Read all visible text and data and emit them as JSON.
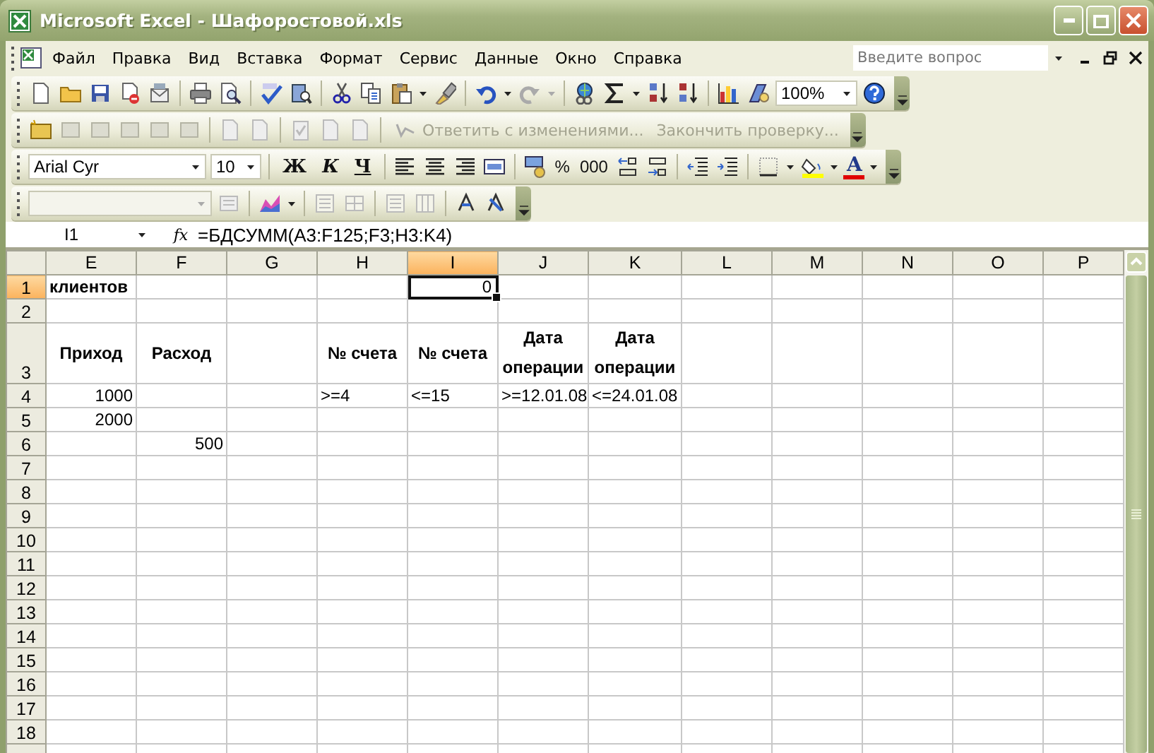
{
  "window": {
    "title": "Microsoft Excel - Шафоростовой.xls"
  },
  "menu": {
    "items": [
      {
        "label": "Файл"
      },
      {
        "label": "Правка"
      },
      {
        "label": "Вид"
      },
      {
        "label": "Вставка"
      },
      {
        "label": "Формат"
      },
      {
        "label": "Сервис"
      },
      {
        "label": "Данные"
      },
      {
        "label": "Окно"
      },
      {
        "label": "Справка"
      }
    ],
    "help_search": {
      "placeholder": "Введите вопрос"
    }
  },
  "standard_toolbar": {
    "zoom": "100%"
  },
  "reviewing_toolbar": {
    "buttons": [
      {
        "label": "Ответить с изменениями...",
        "disabled": true
      },
      {
        "label": "Закончить проверку...",
        "disabled": true
      }
    ]
  },
  "formatting_toolbar": {
    "font": "Arial Cyr",
    "size": "10",
    "style_buttons": [
      {
        "label": "Ж",
        "kind": "bold"
      },
      {
        "label": "К",
        "kind": "italic"
      },
      {
        "label": "Ч",
        "kind": "underline"
      }
    ],
    "number_buttons": [
      {
        "label": "%"
      },
      {
        "label": "000"
      }
    ],
    "font_color_label": "A"
  },
  "formula_bar": {
    "name_box": "I1",
    "function_label": "fx",
    "formula": "=БДСУММ(A3:F125;F3;H3:K4)"
  },
  "sheet": {
    "columns": [
      {
        "label": "E",
        "selected": false
      },
      {
        "label": "F",
        "selected": false
      },
      {
        "label": "G",
        "selected": false
      },
      {
        "label": "H",
        "selected": false
      },
      {
        "label": "I",
        "selected": true
      },
      {
        "label": "J",
        "selected": false
      },
      {
        "label": "K",
        "selected": false
      },
      {
        "label": "L",
        "selected": false
      },
      {
        "label": "M",
        "selected": false
      },
      {
        "label": "N",
        "selected": false
      },
      {
        "label": "O",
        "selected": false
      },
      {
        "label": "P",
        "selected": false
      }
    ],
    "rows": [
      {
        "header": "1",
        "selected": true,
        "cells": [
          {
            "text": "клиентов",
            "kind": "title",
            "selected": false
          },
          null,
          null,
          null,
          {
            "text": "0",
            "kind": "number",
            "selected": true
          },
          null,
          null,
          null,
          null,
          null,
          null,
          null
        ]
      },
      {
        "header": "2",
        "selected": false,
        "cells": [
          null,
          null,
          null,
          null,
          null,
          null,
          null,
          null,
          null,
          null,
          null,
          null
        ]
      },
      {
        "header": "3",
        "selected": false,
        "cells": [
          {
            "text": "Приход",
            "kind": "heading",
            "selected": false
          },
          {
            "text": "Расход",
            "kind": "heading",
            "selected": false
          },
          null,
          {
            "text": "№ счета",
            "kind": "heading",
            "selected": false
          },
          {
            "text": "№ счета",
            "kind": "heading",
            "selected": false
          },
          {
            "text": "Дата операции",
            "kind": "heading",
            "selected": false
          },
          {
            "text": "Дата операции",
            "kind": "heading",
            "selected": false
          },
          null,
          null,
          null,
          null,
          null
        ]
      },
      {
        "header": "4",
        "selected": false,
        "cells": [
          {
            "text": "1000",
            "kind": "number",
            "selected": false
          },
          null,
          null,
          {
            "text": ">=4",
            "kind": "text",
            "selected": false
          },
          {
            "text": "<=15",
            "kind": "text",
            "selected": false
          },
          {
            "text": ">=12.01.08",
            "kind": "text",
            "selected": false
          },
          {
            "text": "<=24.01.08",
            "kind": "text",
            "selected": false
          },
          null,
          null,
          null,
          null,
          null
        ]
      },
      {
        "header": "5",
        "selected": false,
        "cells": [
          {
            "text": "2000",
            "kind": "number",
            "selected": false
          },
          null,
          null,
          null,
          null,
          null,
          null,
          null,
          null,
          null,
          null,
          null
        ]
      },
      {
        "header": "6",
        "selected": false,
        "cells": [
          null,
          {
            "text": "500",
            "kind": "number",
            "selected": false
          },
          null,
          null,
          null,
          null,
          null,
          null,
          null,
          null,
          null,
          null
        ]
      },
      {
        "header": "7",
        "selected": false,
        "cells": [
          null,
          null,
          null,
          null,
          null,
          null,
          null,
          null,
          null,
          null,
          null,
          null
        ]
      },
      {
        "header": "8",
        "selected": false,
        "cells": [
          null,
          null,
          null,
          null,
          null,
          null,
          null,
          null,
          null,
          null,
          null,
          null
        ]
      },
      {
        "header": "9",
        "selected": false,
        "cells": [
          null,
          null,
          null,
          null,
          null,
          null,
          null,
          null,
          null,
          null,
          null,
          null
        ]
      },
      {
        "header": "10",
        "selected": false,
        "cells": [
          null,
          null,
          null,
          null,
          null,
          null,
          null,
          null,
          null,
          null,
          null,
          null
        ]
      },
      {
        "header": "11",
        "selected": false,
        "cells": [
          null,
          null,
          null,
          null,
          null,
          null,
          null,
          null,
          null,
          null,
          null,
          null
        ]
      },
      {
        "header": "12",
        "selected": false,
        "cells": [
          null,
          null,
          null,
          null,
          null,
          null,
          null,
          null,
          null,
          null,
          null,
          null
        ]
      },
      {
        "header": "13",
        "selected": false,
        "cells": [
          null,
          null,
          null,
          null,
          null,
          null,
          null,
          null,
          null,
          null,
          null,
          null
        ]
      },
      {
        "header": "14",
        "selected": false,
        "cells": [
          null,
          null,
          null,
          null,
          null,
          null,
          null,
          null,
          null,
          null,
          null,
          null
        ]
      },
      {
        "header": "15",
        "selected": false,
        "cells": [
          null,
          null,
          null,
          null,
          null,
          null,
          null,
          null,
          null,
          null,
          null,
          null
        ]
      },
      {
        "header": "16",
        "selected": false,
        "cells": [
          null,
          null,
          null,
          null,
          null,
          null,
          null,
          null,
          null,
          null,
          null,
          null
        ]
      },
      {
        "header": "17",
        "selected": false,
        "cells": [
          null,
          null,
          null,
          null,
          null,
          null,
          null,
          null,
          null,
          null,
          null,
          null
        ]
      },
      {
        "header": "18",
        "selected": false,
        "cells": [
          null,
          null,
          null,
          null,
          null,
          null,
          null,
          null,
          null,
          null,
          null,
          null
        ]
      }
    ]
  }
}
